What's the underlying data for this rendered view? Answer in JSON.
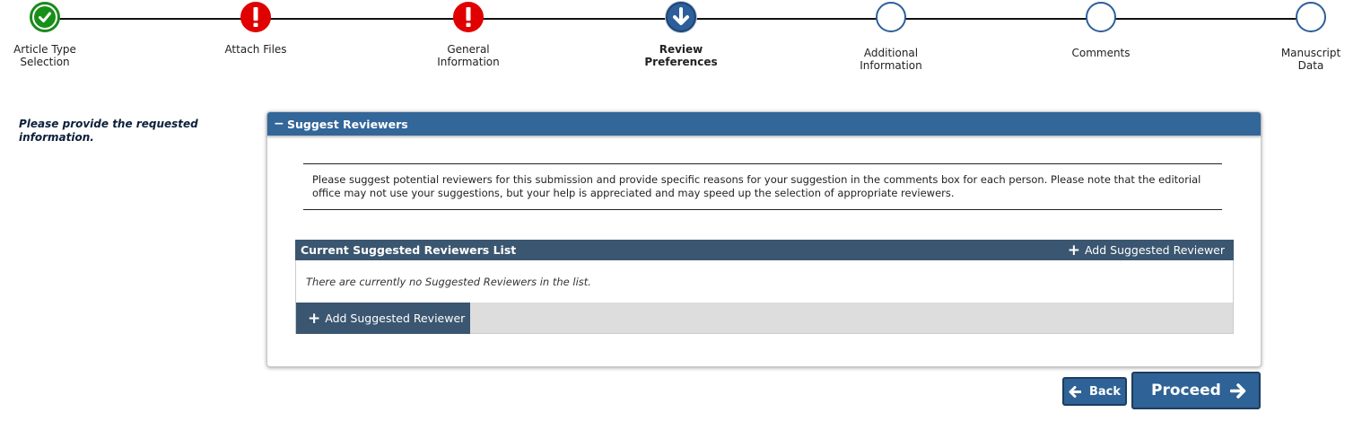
{
  "steps": [
    {
      "label_line1": "Article Type",
      "label_line2": "Selection",
      "status": "complete"
    },
    {
      "label_line1": "Attach Files",
      "label_line2": "",
      "status": "error"
    },
    {
      "label_line1": "General",
      "label_line2": "Information",
      "status": "error"
    },
    {
      "label_line1": "Review",
      "label_line2": "Preferences",
      "status": "current"
    },
    {
      "label_line1": "Additional",
      "label_line2": "Information",
      "status": "incomplete"
    },
    {
      "label_line1": "Comments",
      "label_line2": "",
      "status": "incomplete"
    },
    {
      "label_line1": "Manuscript",
      "label_line2": "Data",
      "status": "incomplete"
    }
  ],
  "instructions": "Please provide the requested information.",
  "panel": {
    "title": "Suggest Reviewers",
    "intro": "Please suggest potential reviewers for this submission and provide specific reasons for your suggestion in the comments box for each person. Please note that the editorial office may not use your suggestions, but your help is appreciated and may speed up the selection of appropriate reviewers.",
    "list_title": "Current Suggested Reviewers List",
    "add_link_label": "Add Suggested Reviewer",
    "empty_message": "There are currently no Suggested Reviewers in the list.",
    "add_button_label": "Add Suggested Reviewer"
  },
  "nav": {
    "back_label": "Back",
    "proceed_label": "Proceed"
  },
  "colors": {
    "primary": "#336699",
    "list_header": "#3b5670",
    "success": "#179017",
    "error": "#e00000"
  }
}
